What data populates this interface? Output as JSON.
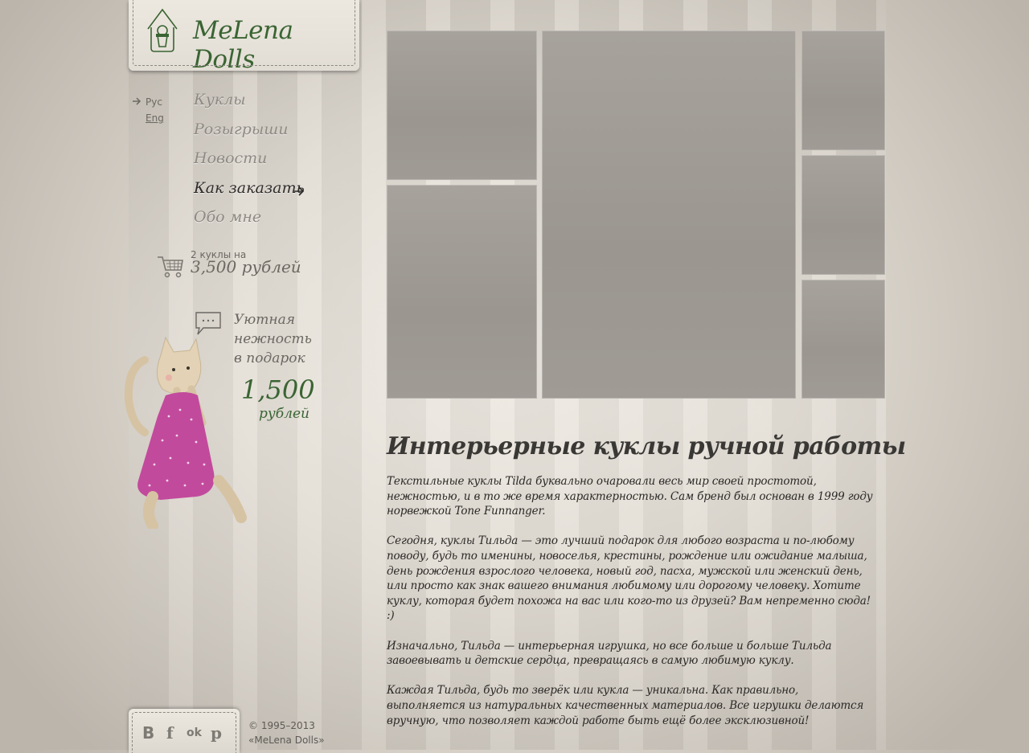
{
  "site": {
    "logo_text": "MeLena Dolls"
  },
  "lang": {
    "ru": "Рус",
    "en": "Eng"
  },
  "menu": {
    "items": [
      {
        "label": "Куклы",
        "active": false
      },
      {
        "label": "Розыгрыши",
        "active": false
      },
      {
        "label": "Новости",
        "active": false
      },
      {
        "label": "Как заказать",
        "active": true
      },
      {
        "label": "Обо мне",
        "active": false
      }
    ]
  },
  "cart": {
    "line1": "2 куклы на",
    "line2": "3,500 рублей"
  },
  "promo": {
    "text_lines": [
      "Уютная",
      "нежность",
      "в подарок"
    ],
    "price": "1,500",
    "currency": "рублей"
  },
  "footer": {
    "social": [
      "В",
      "f",
      "ok",
      "p"
    ],
    "copyright_line1": "© 1995–2013",
    "copyright_line2": "«MeLena Dolls»"
  },
  "main": {
    "heading": "Интерьерные куклы ручной работы",
    "paragraphs": [
      "Текстильные куклы Tilda буквально очаровали весь мир своей простотой, нежностью, и в то же время характерностью. Сам бренд был основан в 1999 году норвежкой Tone Funnanger.",
      "Сегодня, куклы Тильда — это лучший подарок для любого возраста и по-любому поводу, будь то именины, новоселья, крестины, рождение или ожидание малыша, день рождения взрослого человека, новый год, пасха, мужской или женский день, или просто как знак вашего внимания любимому или дорогому человеку. Хотите куклу, которая будет похожа на вас или кого-то из друзей? Вам непременно сюда! :)",
      "Изначально, Тильда — интерьерная игрушка, но все больше и больше Тильда завоевывать и детские сердца, превращаясь в самую любимую куклу.",
      "Каждая Тильда, будь то зверёк или кукла — уникальна. Как правильно, выполняется из натуральных качественных материалов. Все игрушки делаются вручную, что позволяет каждой работе быть ещё более эксклюзивной!"
    ]
  },
  "colors": {
    "accent_green": "#3a6433",
    "text_dark": "#2b2926",
    "menu_gray": "#8e8a83"
  }
}
